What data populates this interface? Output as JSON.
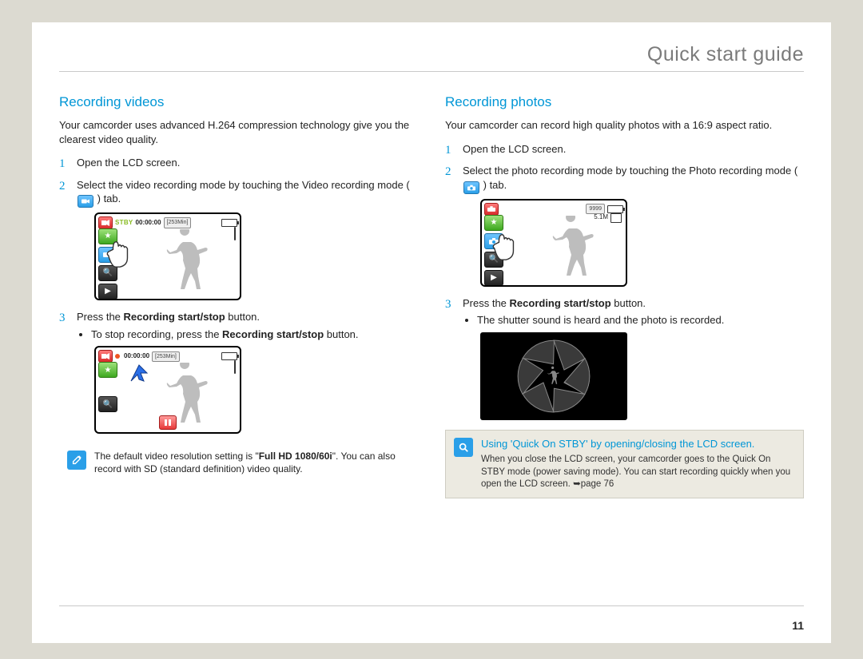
{
  "page_title": "Quick start guide",
  "page_number": "11",
  "left": {
    "heading": "Recording videos",
    "intro": "Your camcorder uses advanced H.264 compression technology give you the clearest video quality.",
    "step1": "Open the LCD screen.",
    "step2_a": "Select the video recording mode by touching the Video recording mode (",
    "step2_b": ") tab.",
    "step3_a": "Press the ",
    "step3_b": "Recording start/stop",
    "step3_c": " button.",
    "step3_bullet_a": "To stop recording, press the ",
    "step3_bullet_b": "Recording start/stop",
    "step3_bullet_c": " button.",
    "note_a": "The default video resolution setting is \"",
    "note_b": "Full HD  1080/60i",
    "note_c": "\". You can also record with SD (standard definition) video quality.",
    "lcd_stby_label": "STBY",
    "lcd_timecode": "00:00:00",
    "lcd_remaining": "[253Min]"
  },
  "right": {
    "heading": "Recording photos",
    "intro": "Your camcorder can record high quality photos with a 16:9 aspect ratio.",
    "step1": "Open the LCD screen.",
    "step2_a": "Select the photo recording mode by touching the Photo recording mode (",
    "step2_b": ") tab.",
    "step3_a": "Press the ",
    "step3_b": "Recording start/stop",
    "step3_c": " button.",
    "step3_bullet": "The shutter sound is heard and the photo is recorded.",
    "lcd_count": "9999",
    "info_title": "Using 'Quick On STBY' by opening/closing the LCD screen.",
    "info_body_a": "When you close the LCD screen, your camcorder goes to the Quick On STBY mode (power saving mode). You can start recording quickly when you open the LCD screen. ",
    "info_body_ref": "➥page 76"
  }
}
